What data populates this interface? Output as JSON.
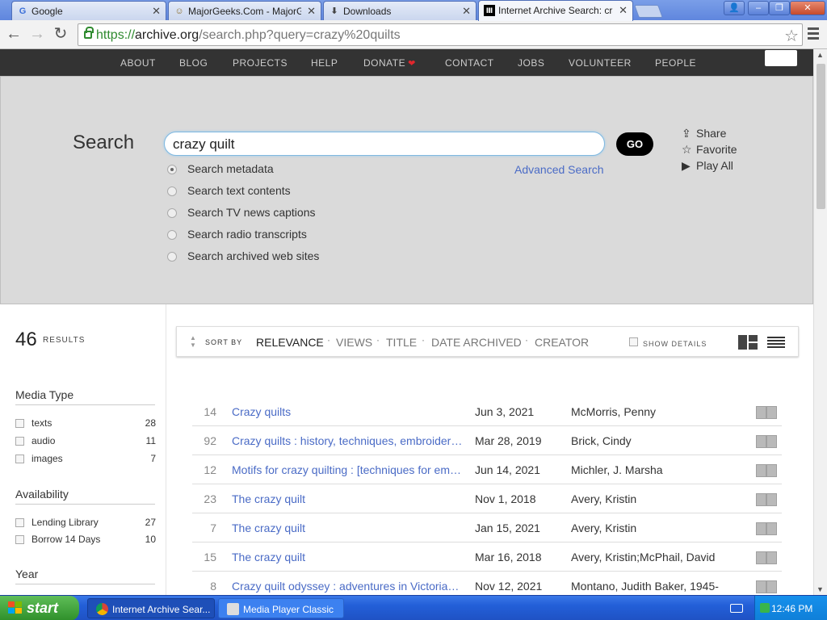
{
  "browser": {
    "tabs": [
      {
        "title": "Google",
        "icon": "google-icon"
      },
      {
        "title": "MajorGeeks.Com - MajorGeeks",
        "icon": "majorgeeks-icon"
      },
      {
        "title": "Downloads",
        "icon": "download-icon"
      },
      {
        "title": "Internet Archive Search: crazy",
        "icon": "archive-icon"
      }
    ],
    "url": {
      "scheme": "https://",
      "host": "archive.org",
      "path": "/search.php?query=crazy%20quilts"
    }
  },
  "nav": {
    "items": [
      "ABOUT",
      "BLOG",
      "PROJECTS",
      "HELP",
      "DONATE",
      "CONTACT",
      "JOBS",
      "VOLUNTEER",
      "PEOPLE"
    ]
  },
  "search": {
    "label": "Search",
    "query": "crazy quilt",
    "go": "GO",
    "advanced": "Advanced Search",
    "options": [
      "Search metadata",
      "Search text contents",
      "Search TV news captions",
      "Search radio transcripts",
      "Search archived web sites"
    ],
    "selected_option": "Search metadata",
    "actions": [
      "Share",
      "Favorite",
      "Play All"
    ]
  },
  "facets": {
    "count": "46",
    "count_label": "RESULTS",
    "media_type": {
      "title": "Media Type",
      "items": [
        {
          "label": "texts",
          "count": "28"
        },
        {
          "label": "audio",
          "count": "11"
        },
        {
          "label": "images",
          "count": "7"
        }
      ]
    },
    "availability": {
      "title": "Availability",
      "items": [
        {
          "label": "Lending Library",
          "count": "27"
        },
        {
          "label": "Borrow 14 Days",
          "count": "10"
        }
      ]
    },
    "year": {
      "title": "Year"
    }
  },
  "sort": {
    "label": "SORT BY",
    "options": [
      "RELEVANCE",
      "VIEWS",
      "TITLE",
      "DATE ARCHIVED",
      "CREATOR"
    ],
    "active": "RELEVANCE",
    "show_details": "SHOW DETAILS"
  },
  "results": [
    {
      "n": "14",
      "title": "Crazy quilts",
      "date": "Jun 3, 2021",
      "creator": "McMorris, Penny"
    },
    {
      "n": "92",
      "title": "Crazy quilts : history, techniques, embroidery motifs",
      "date": "Mar 28, 2019",
      "creator": "Brick, Cindy"
    },
    {
      "n": "12",
      "title": "Motifs for crazy quilting : [techniques for embellishing]",
      "date": "Jun 14, 2021",
      "creator": "Michler, J. Marsha"
    },
    {
      "n": "23",
      "title": "The crazy quilt",
      "date": "Nov 1, 2018",
      "creator": "Avery, Kristin"
    },
    {
      "n": "7",
      "title": "The crazy quilt",
      "date": "Jan 15, 2021",
      "creator": "Avery, Kristin"
    },
    {
      "n": "15",
      "title": "The crazy quilt",
      "date": "Mar 16, 2018",
      "creator": "Avery, Kristin;McPhail, David"
    },
    {
      "n": "8",
      "title": "Crazy quilt odyssey : adventures in Victorian needlework",
      "date": "Nov 12, 2021",
      "creator": "Montano, Judith Baker, 1945-"
    }
  ],
  "taskbar": {
    "start": "start",
    "buttons": [
      "Internet Archive Sear...",
      "Media Player Classic"
    ],
    "clock": "12:46 PM"
  },
  "colors": {
    "link": "#4a6bc6",
    "nav_bg": "#333333",
    "panel_bg": "#dadada",
    "taskbar": "#235fd8",
    "start": "#2e8f2a"
  }
}
